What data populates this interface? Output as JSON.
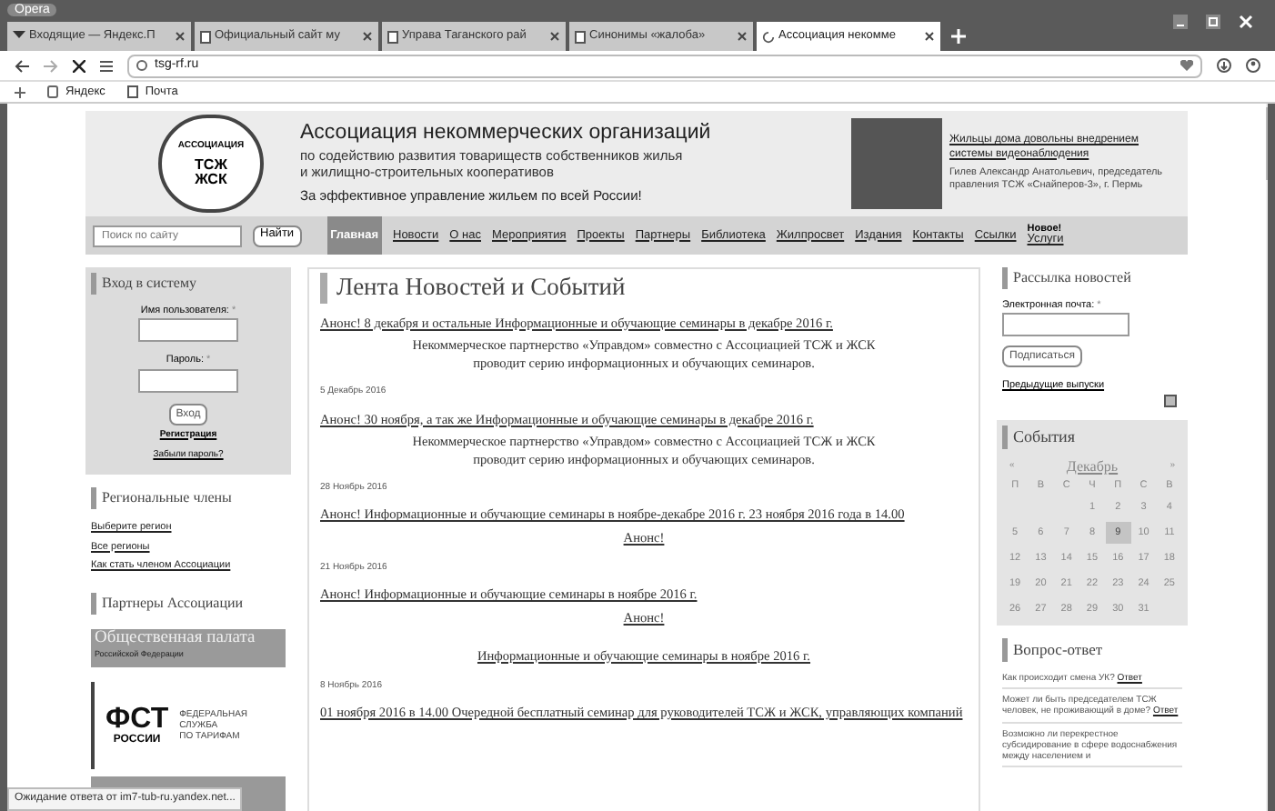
{
  "window": {
    "title": "Opera"
  },
  "tabs": [
    {
      "label": "Входящие — Яндекс.П",
      "selected": false,
      "kind": "mail"
    },
    {
      "label": "Официальный сайт му",
      "selected": false,
      "kind": "page"
    },
    {
      "label": "Управа Таганского рай",
      "selected": false,
      "kind": "page"
    },
    {
      "label": "Синонимы «жалоба»",
      "selected": false,
      "kind": "page"
    },
    {
      "label": "Ассоциация некомме",
      "selected": true,
      "kind": "loading"
    }
  ],
  "address_bar": {
    "url": "tsg-rf.ru"
  },
  "bookmarks": [
    {
      "label": "Яндекс",
      "kind": "yandex"
    },
    {
      "label": "Почта",
      "kind": "page"
    }
  ],
  "header": {
    "logo": {
      "top": "АССОЦИАЦИЯ",
      "line_1": "ТСЖ",
      "line_2": "ЖСК"
    },
    "title": "Ассоциация некоммерческих организаций",
    "subtitle_1": "по содействию развития товариществ собственников жилья",
    "subtitle_2": "и жилищно-строительных кооперативов",
    "slogan": "За эффективное управление жильем по всей России!",
    "feature": {
      "link": "Жильцы дома довольны внедрением системы видеонаблюдения",
      "caption": "Гилев Александр Анатольевич, председатель правления ТСЖ «Снайперов-3», г. Пермь"
    }
  },
  "search": {
    "placeholder": "Поиск по сайту",
    "button": "Найти"
  },
  "nav": [
    {
      "label": "Главная",
      "selected": true
    },
    {
      "label": "Новости",
      "selected": false
    },
    {
      "label": "О нас",
      "selected": false
    },
    {
      "label": "Мероприятия",
      "selected": false
    },
    {
      "label": "Проекты",
      "selected": false
    },
    {
      "label": "Партнеры",
      "selected": false
    },
    {
      "label": "Библиотека",
      "selected": false
    },
    {
      "label": "Жилпросвет",
      "selected": false
    },
    {
      "label": "Издания",
      "selected": false
    },
    {
      "label": "Контакты",
      "selected": false
    },
    {
      "label": "Ссылки",
      "selected": false
    },
    {
      "label": "Услуги",
      "badge": "Новое!",
      "selected": false
    }
  ],
  "login": {
    "title": "Вход в систему",
    "username_label": "Имя пользователя:",
    "password_label": "Пароль:",
    "required_mark": "*",
    "button": "Вход",
    "register": "Регистрация",
    "forgot": "Забыли пароль?"
  },
  "regional": {
    "title": "Региональные члены",
    "links": [
      "Выберите регион",
      "Все регионы",
      "Как стать членом Ассоциации"
    ]
  },
  "partners": {
    "title": "Партнеры Ассоциации",
    "banner_1": {
      "title": "Общественная палата",
      "subtitle": "Российской Федерации"
    },
    "banner_2": {
      "abbr": "ФСТ",
      "country": "РОССИИ",
      "name_1": "ФЕДЕРАЛЬНАЯ",
      "name_2": "СЛУЖБА",
      "name_3": "ПО ТАРИФАМ"
    }
  },
  "news": {
    "title": "Лента Новостей и Событий",
    "items": [
      {
        "title": "Анонс! 8 декабря и остальные Информационные и обучающие семинары в декабре 2016 г.",
        "body": [
          {
            "kind": "text",
            "text": "Некоммерческое партнерство «Управдом» совместно с Ассоциацией ТСЖ и ЖСК проводит серию информационных и обучающих семинаров."
          }
        ],
        "date": "5 Декабрь 2016"
      },
      {
        "title": "Анонс! 30 ноября, а так же Информационные и обучающие семинары в декабре 2016 г.",
        "body": [
          {
            "kind": "text",
            "text": "Некоммерческое партнерство «Управдом» совместно с Ассоциацией ТСЖ и ЖСК проводит серию информационных и обучающих семинаров."
          }
        ],
        "date": "28 Ноябрь 2016"
      },
      {
        "title": "Анонс! Информационные и обучающие семинары в ноябре-декабре 2016 г. 23 ноября 2016 года в 14.00",
        "body": [
          {
            "kind": "link",
            "text": "Анонс!"
          }
        ],
        "date": "21 Ноябрь 2016"
      },
      {
        "title": "Анонс! Информационные и обучающие семинары в ноябре 2016 г.",
        "body": [
          {
            "kind": "link",
            "text": "Анонс!"
          },
          {
            "kind": "link",
            "text": "Информационные и обучающие семинары в ноябре 2016 г."
          }
        ],
        "date": "8 Ноябрь 2016"
      },
      {
        "title": "01 ноября 2016 в 14.00 Очередной бесплатный семинар для руководителей ТСЖ и ЖСК, управляющих компаний"
      }
    ]
  },
  "newsletter": {
    "title": "Рассылка новостей",
    "email_label": "Электронная почта:",
    "required_mark": "*",
    "button": "Подписаться",
    "archive": "Предыдущие выпуски"
  },
  "events": {
    "title": "События",
    "prev": "«",
    "month": "Декабрь",
    "next": "»",
    "weekdays": [
      "П",
      "В",
      "С",
      "Ч",
      "П",
      "С",
      "В"
    ],
    "weeks": [
      [
        {
          "day": "1",
          "selected": false
        },
        {
          "day": "2",
          "selected": false
        },
        {
          "day": "3",
          "selected": false
        },
        {
          "day": "4",
          "selected": false
        }
      ],
      [
        {
          "day": "5",
          "selected": false
        },
        {
          "day": "6",
          "selected": false
        },
        {
          "day": "7",
          "selected": false
        },
        {
          "day": "8",
          "selected": false
        },
        {
          "day": "9",
          "selected": true
        },
        {
          "day": "10",
          "selected": false
        },
        {
          "day": "11",
          "selected": false
        }
      ],
      [
        {
          "day": "12",
          "selected": false
        },
        {
          "day": "13",
          "selected": false
        },
        {
          "day": "14",
          "selected": false
        },
        {
          "day": "15",
          "selected": false
        },
        {
          "day": "16",
          "selected": false
        },
        {
          "day": "17",
          "selected": false
        },
        {
          "day": "18",
          "selected": false
        }
      ],
      [
        {
          "day": "19",
          "selected": false
        },
        {
          "day": "20",
          "selected": false
        },
        {
          "day": "21",
          "selected": false
        },
        {
          "day": "22",
          "selected": false
        },
        {
          "day": "23",
          "selected": false
        },
        {
          "day": "24",
          "selected": false
        },
        {
          "day": "25",
          "selected": false
        }
      ],
      [
        {
          "day": "26",
          "selected": false
        },
        {
          "day": "27",
          "selected": false
        },
        {
          "day": "28",
          "selected": false
        },
        {
          "day": "29",
          "selected": false
        },
        {
          "day": "30",
          "selected": false
        },
        {
          "day": "31",
          "selected": false
        }
      ]
    ]
  },
  "faq": {
    "title": "Вопрос-ответ",
    "items": [
      {
        "question": "Как происходит смена УК?",
        "answer": "Ответ"
      },
      {
        "question": "Может ли быть председателем ТСЖ человек, не проживающий в доме?",
        "answer": "Ответ"
      },
      {
        "question": "Возможно ли перекрестное субсидирование в сфере водоснабжения между населением и"
      }
    ]
  },
  "status_bar": {
    "text": "Ожидание ответа от im7-tub-ru.yandex.net..."
  }
}
